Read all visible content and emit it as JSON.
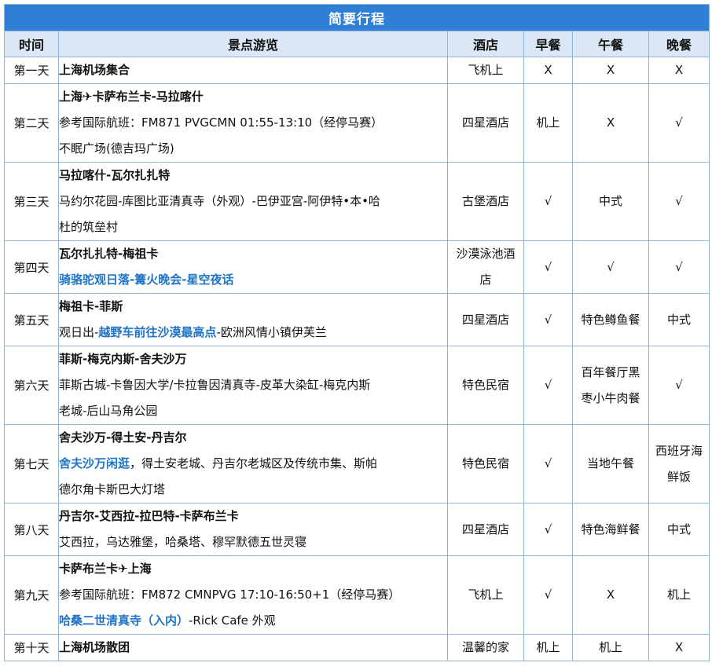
{
  "title": "简要行程",
  "headers": [
    "时间",
    "景点游览",
    "酒店",
    "早餐",
    "午餐",
    "晚餐"
  ],
  "days": [
    {
      "day": "第一天",
      "route_title": "上海机场集合",
      "details": [],
      "hotel": "飞机上",
      "breakfast": "X",
      "lunch": "X",
      "dinner": "X"
    },
    {
      "day": "第二天",
      "route_title": "上海✈卡萨布兰卡-马拉喀什",
      "details": [
        [
          {
            "t": "参考国际航班：FM871 PVGCMN 01:55-13:10（经停马赛）"
          }
        ],
        [
          {
            "t": "不眠广场(德吉玛广场)"
          }
        ]
      ],
      "hotel": "四星酒店",
      "breakfast": "机上",
      "lunch": "X",
      "dinner": "√"
    },
    {
      "day": "第三天",
      "route_title": "马拉喀什-瓦尔扎扎特",
      "details": [
        [
          {
            "t": "马约尔花园-库图比亚清真寺（外观）-巴伊亚宫-阿伊特•本•哈"
          }
        ],
        [
          {
            "t": "杜的筑垒村"
          }
        ]
      ],
      "hotel": "古堡酒店",
      "breakfast": "√",
      "lunch": "中式",
      "dinner": "√"
    },
    {
      "day": "第四天",
      "route_title": "瓦尔扎扎特-梅祖卡",
      "details": [
        [
          {
            "t": "骑骆驼观日落-篝火晚会-星空夜话",
            "hl": true
          }
        ]
      ],
      "hotel": "沙漠泳池酒店",
      "breakfast": "√",
      "lunch": "√",
      "dinner": "√"
    },
    {
      "day": "第五天",
      "route_title": "梅祖卡-菲斯",
      "details": [
        [
          {
            "t": "观日出-"
          },
          {
            "t": "越野车前往沙漠最高点",
            "hl": true
          },
          {
            "t": "-欧洲风情小镇伊芙兰"
          }
        ]
      ],
      "hotel": "四星酒店",
      "breakfast": "√",
      "lunch": "特色鳟鱼餐",
      "dinner": "中式"
    },
    {
      "day": "第六天",
      "route_title": "菲斯-梅克内斯-舍夫沙万",
      "details": [
        [
          {
            "t": "菲斯古城-卡鲁因大学/卡拉鲁因清真寺-皮革大染缸-梅克内斯"
          }
        ],
        [
          {
            "t": "老城-后山马角公园"
          }
        ]
      ],
      "hotel": "特色民宿",
      "breakfast": "√",
      "lunch": "百年餐厅黑枣小牛肉餐",
      "dinner": "√"
    },
    {
      "day": "第七天",
      "route_title": "舍夫沙万-得土安-丹吉尔",
      "details": [
        [
          {
            "t": "舍夫沙万闲逛",
            "hl": true
          },
          {
            "t": "，得土安老城、丹吉尔老城区及传统市集、斯帕"
          }
        ],
        [
          {
            "t": "德尔角卡斯巴大灯塔"
          }
        ]
      ],
      "hotel": "特色民宿",
      "breakfast": "√",
      "lunch": "当地午餐",
      "dinner": "西班牙海鲜饭"
    },
    {
      "day": "第八天",
      "route_title": "丹吉尔-艾西拉-拉巴特-卡萨布兰卡",
      "details": [
        [
          {
            "t": "艾西拉，乌达雅堡，哈桑塔、穆罕默德五世灵寝"
          }
        ]
      ],
      "hotel": "四星酒店",
      "breakfast": "√",
      "lunch": "特色海鲜餐",
      "dinner": "中式"
    },
    {
      "day": "第九天",
      "route_title": "卡萨布兰卡✈上海",
      "details": [
        [
          {
            "t": "参考国际航班：FM872 CMNPVG 17:10-16:50+1（经停马赛）"
          }
        ],
        [
          {
            "t": "哈桑二世清真寺（入内）",
            "hl": true
          },
          {
            "t": "-Rick Cafe 外观"
          }
        ]
      ],
      "hotel": "飞机上",
      "breakfast": "√",
      "lunch": "X",
      "dinner": "机上"
    },
    {
      "day": "第十天",
      "route_title": "上海机场散团",
      "details": [],
      "hotel": "温馨的家",
      "breakfast": "机上",
      "lunch": "机上",
      "dinner": "X"
    }
  ]
}
